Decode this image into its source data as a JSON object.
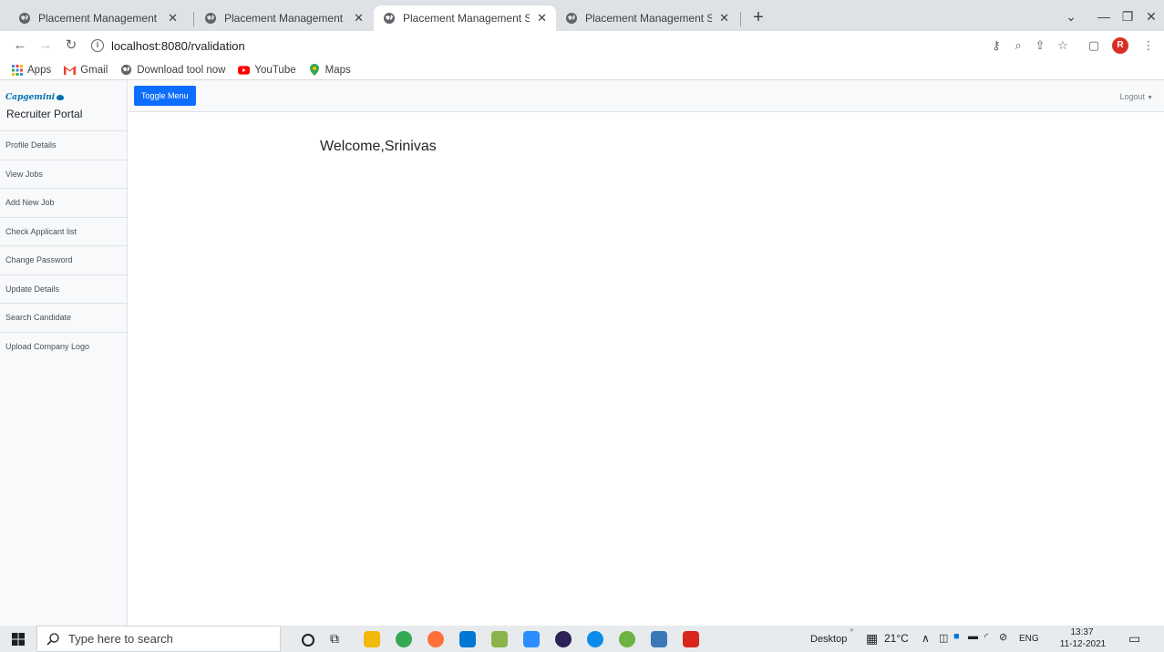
{
  "browser": {
    "tabs": [
      {
        "title": "Placement Management System",
        "active": false
      },
      {
        "title": "Placement Management System",
        "active": false
      },
      {
        "title": "Placement Management System",
        "active": true
      },
      {
        "title": "Placement Management System",
        "active": false
      }
    ],
    "url": "localhost:8080/rvalidation",
    "profile_initial": "R",
    "bookmarks": [
      {
        "label": "Apps",
        "icon": "apps-grid-icon"
      },
      {
        "label": "Gmail",
        "icon": "gmail-icon"
      },
      {
        "label": "Download tool now",
        "icon": "globe-icon"
      },
      {
        "label": "YouTube",
        "icon": "youtube-icon"
      },
      {
        "label": "Maps",
        "icon": "maps-icon"
      }
    ]
  },
  "sidebar": {
    "brand": "Capgemini",
    "title": "Recruiter Portal",
    "items": [
      {
        "label": "Profile Details"
      },
      {
        "label": "View Jobs"
      },
      {
        "label": "Add New Job"
      },
      {
        "label": "Check Applicant list"
      },
      {
        "label": "Change Password"
      },
      {
        "label": "Update Details"
      },
      {
        "label": "Search Candidate"
      },
      {
        "label": "Upload Company Logo"
      }
    ]
  },
  "topnav": {
    "toggle_label": "Toggle Menu",
    "logout_label": "Logout"
  },
  "main": {
    "welcome": "Welcome,Srinivas"
  },
  "taskbar": {
    "search_placeholder": "Type here to search",
    "desktop_label": "Desktop",
    "weather": "21°C",
    "language": "ENG",
    "time": "13:37",
    "date": "11-12-2021"
  },
  "colors": {
    "accent": "#0d6efd",
    "brand": "#0070ad"
  }
}
